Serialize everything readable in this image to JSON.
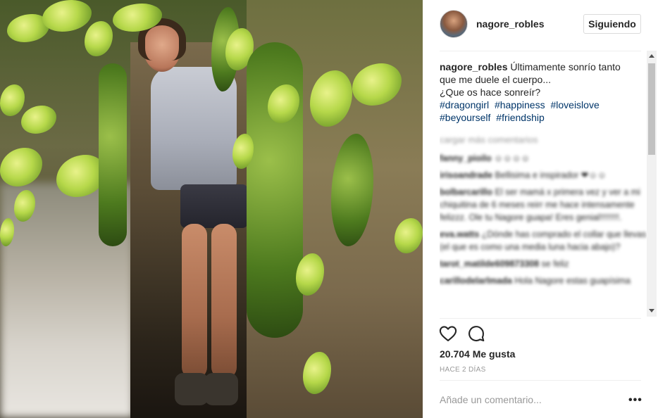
{
  "post": {
    "username": "nagore_robles",
    "follow_label": "Siguiendo",
    "caption": {
      "user": "nagore_robles",
      "text_line1": " Últimamente sonrío tanto",
      "text_line2": "que me duele el cuerpo...",
      "text_line3": "¿Que os hace sonreír?",
      "hashtags": [
        "#dragongirl",
        "#happiness",
        "#loveislove",
        "#beyourself",
        "#friendship"
      ]
    },
    "load_more": "cargar más comentarios",
    "comments": [
      {
        "user": "fanny_pioilo",
        "text": "☺☺☺☺"
      },
      {
        "user": "irisoandrade",
        "text": "Bellisima e inspirador ❤☺☺"
      },
      {
        "user": "bolbarcarillo",
        "text": "El ser mamá x primera vez y ver a mi chiquitina de 6 meses reirr me hace intensamente felizzz. Ole tu Nagore guapa! Eres genial!!!!!!!!."
      },
      {
        "user": "eva.watts",
        "text": "¿Dónde has comprado el collar que llevas (el que es como una media luna hacia abajo)?"
      },
      {
        "user": "tarot_matilde609873308",
        "text": "se feliz"
      },
      {
        "user": "carillodelarlmada",
        "text": "Hola Nagore estas guapísima"
      }
    ],
    "likes": "20.704 Me gusta",
    "time": "HACE 2 DÍAS",
    "add_comment_placeholder": "Añade un comentario...",
    "more_label": "•••"
  },
  "colors": {
    "hashtag": "#003569",
    "muted": "#999999",
    "border": "#dbdbdb"
  },
  "icons": {
    "like": "heart-icon",
    "comment": "speech-bubble-icon",
    "more": "ellipsis-icon"
  }
}
